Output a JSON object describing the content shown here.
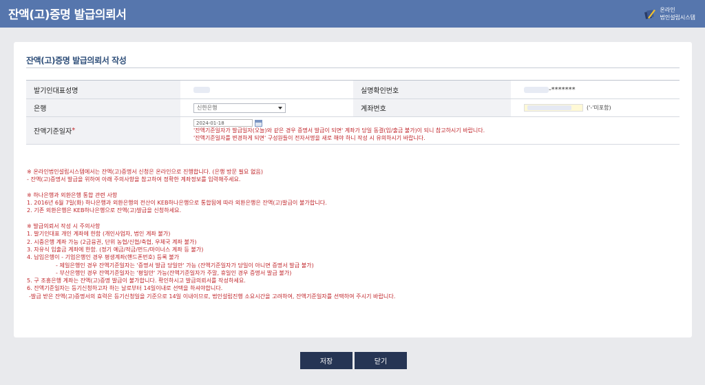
{
  "header": {
    "title": "잔액(고)증명 발급의뢰서",
    "logo_line1": "온라인",
    "logo_line2": "법인설립시스템"
  },
  "section": {
    "title": "잔액(고)증명 발급의뢰서 작성"
  },
  "form": {
    "rep_name_label": "발기인대표성명",
    "id_label": "실명확인번호",
    "id_masked_suffix": "-*******",
    "bank_label": "은행",
    "bank_selected": "신한은행",
    "account_label": "계좌번호",
    "account_note": "('-'미포함)",
    "date_label": "잔액기준일자",
    "date_required": "*",
    "date_value": "2024-01-18",
    "warning1": "'잔액기준일자가 발급일자(오늘)와 같은 경우 증명서 발급이 되면' 계좌가 당일 동결(입/출금 불가)이 되니 참고하시기 바랍니다.",
    "warning2": "'잔액기준일자를 변경하게 되면' 구성원들이 전자서명을 새로 해야 하니 작성 시 유의하시기 바랍니다."
  },
  "notices": [
    "※ 온라인법인설립시스템에서는 잔액(고)증명서 신청은 온라인으로 진행합니다. (은행 방문 필요 없음)",
    "- 잔액(고)증명서 발급을 위하여 아래 주의사항을 참고하여 정확한 계좌정보를 입력해주세요.",
    "",
    "※ 하나은행과 외환은행 통합 관련 사항",
    "1. 2016년 6월 7일(화) 하나은행과 외환은행의 전산이 KEB하나은행으로 통합됨에 따라 외환은행은 잔액(고)발급이 불가합니다.",
    "2. 기존 외환은행은 KEB하나은행으로 잔액(고)발급을 신청하세요.",
    "",
    "※ 발급의뢰서 작성 시 주의사항",
    "1. 발기인대표 개인 계좌에 한함 (개인사업자, 법인 계좌 불가)",
    "2. 시중은행 계좌 가능 (2금융권, 단위 농협/신협/축협, 우체국 계좌 불가)",
    "3. 자유식 입출금 계좌에 한함. (정기 예금/적금/펀드/마이너스 계좌 등 불가)",
    "4. 납입은행이 - 기업은행인 경우 평생계좌(핸드폰번호) 등록 불가",
    "- 제일은행인 경우 잔액기준일자는 '증명서 발급 당일만' 가능 (잔액기준일자가 당일이 아니면 증명서 발급 불가)",
    "- 부산은행인 경우 잔액기준일자는 '평일만' 가능(잔액기준일자가 주말, 휴일인 경우 증명서 발급 불가)",
    "5. 구 조흥은행 계좌는 잔액(고)증명 발급이 불가합니다. 확인하시고 발급의뢰서를 작성하세요.",
    "6. 잔액기준일자는 등기신청하고자 하는 날로부터 14일이내로 선택을 하셔야합니다.",
    "-발급 받은 잔액(고)증명서의 효력은 등기신청일을 기준으로 14일 이내이므로, 법인설립진행 소요시간을 고려하여, 잔액기준일자를 선택하여 주시기 바랍니다."
  ],
  "buttons": {
    "save": "저장",
    "close": "닫기"
  },
  "colors": {
    "header": "#5676ad",
    "button": "#263554",
    "notice": "#c0262b"
  }
}
